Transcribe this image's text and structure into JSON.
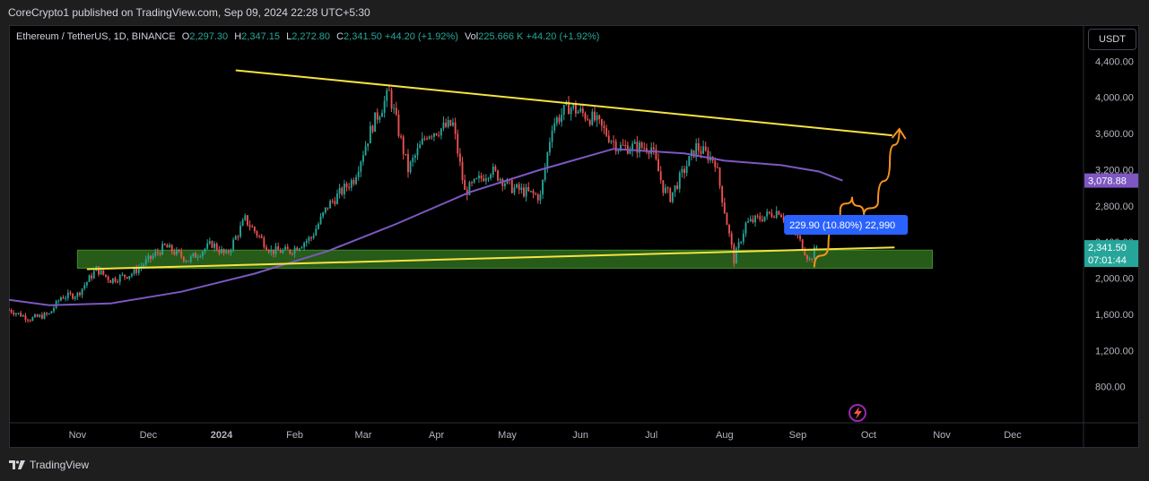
{
  "header": {
    "published_text": "CoreCrypto1 published on TradingView.com, Sep 09, 2024 22:28 UTC+5:30"
  },
  "legend": {
    "symbol": "Ethereum / TetherUS, 1D, BINANCE",
    "o_label": "O",
    "o_value": "2,297.30",
    "h_label": "H",
    "h_value": "2,347.15",
    "l_label": "L",
    "l_value": "2,272.80",
    "c_label": "C",
    "c_value": "2,341.50",
    "change": "+44.20 (+1.92%)",
    "vol_label": "Vol",
    "vol_value": "225.666 K",
    "vol_change": "+44.20 (+1.92%)"
  },
  "currency_button": "USDT",
  "footer": {
    "brand": "TradingView"
  },
  "colors": {
    "up": "#26a69a",
    "down": "#ef5350",
    "ma": "#7e57c2",
    "trendline": "#f6e33f",
    "support_zone": "#2e6b1f",
    "projection": "#f7931a",
    "measure": "#2962ff"
  },
  "icons": {
    "logo": "tradingview-logo-icon",
    "lightning": "lightning-icon"
  },
  "chart_data": {
    "type": "candlestick",
    "y_ticks": [
      "4,400.00",
      "4,000.00",
      "3,600.00",
      "3,200.00",
      "2,800.00",
      "2,400.00",
      "2,000.00",
      "1,600.00",
      "1,200.00",
      "800.00"
    ],
    "y_tick_values": [
      4400,
      4000,
      3600,
      3200,
      2800,
      2400,
      2000,
      1600,
      1200,
      800
    ],
    "ylim": [
      400,
      4800
    ],
    "x_ticks": [
      "Nov",
      "Dec",
      "2024",
      "Feb",
      "Mar",
      "Apr",
      "May",
      "Jun",
      "Jul",
      "Aug",
      "Sep",
      "Oct",
      "Nov",
      "Dec"
    ],
    "x_tick_dates": [
      "2023-11-01",
      "2023-12-01",
      "2024-01-01",
      "2024-02-01",
      "2024-03-01",
      "2024-04-01",
      "2024-05-01",
      "2024-06-01",
      "2024-07-01",
      "2024-08-01",
      "2024-09-01",
      "2024-10-01",
      "2024-11-01",
      "2024-12-01"
    ],
    "xlim": [
      "2023-10-03",
      "2024-12-31"
    ],
    "price_path": [
      [
        "2023-10-03",
        1650
      ],
      [
        "2023-10-12",
        1550
      ],
      [
        "2023-10-20",
        1600
      ],
      [
        "2023-10-25",
        1790
      ],
      [
        "2023-11-01",
        1820
      ],
      [
        "2023-11-09",
        2100
      ],
      [
        "2023-11-15",
        1980
      ],
      [
        "2023-11-24",
        2050
      ],
      [
        "2023-12-08",
        2350
      ],
      [
        "2023-12-18",
        2200
      ],
      [
        "2023-12-28",
        2380
      ],
      [
        "2024-01-03",
        2250
      ],
      [
        "2024-01-11",
        2650
      ],
      [
        "2024-01-22",
        2300
      ],
      [
        "2024-01-30",
        2300
      ],
      [
        "2024-02-08",
        2450
      ],
      [
        "2024-02-15",
        2800
      ],
      [
        "2024-02-26",
        3100
      ],
      [
        "2024-03-05",
        3700
      ],
      [
        "2024-03-12",
        4050
      ],
      [
        "2024-03-20",
        3200
      ],
      [
        "2024-03-28",
        3600
      ],
      [
        "2024-04-08",
        3700
      ],
      [
        "2024-04-13",
        2950
      ],
      [
        "2024-04-24",
        3200
      ],
      [
        "2024-05-03",
        3000
      ],
      [
        "2024-05-15",
        2900
      ],
      [
        "2024-05-20",
        3700
      ],
      [
        "2024-05-27",
        3900
      ],
      [
        "2024-06-07",
        3750
      ],
      [
        "2024-06-17",
        3450
      ],
      [
        "2024-07-01",
        3450
      ],
      [
        "2024-07-06",
        3000
      ],
      [
        "2024-07-09",
        2900
      ],
      [
        "2024-07-20",
        3450
      ],
      [
        "2024-07-28",
        3300
      ],
      [
        "2024-08-05",
        2200
      ],
      [
        "2024-08-10",
        2600
      ],
      [
        "2024-08-24",
        2750
      ],
      [
        "2024-09-01",
        2450
      ],
      [
        "2024-09-06",
        2200
      ],
      [
        "2024-09-09",
        2341.5
      ]
    ],
    "last_close": 2341.5,
    "moving_average": {
      "name": "",
      "current_value": "3,078.88",
      "points": [
        [
          "2023-10-03",
          1760
        ],
        [
          "2023-10-20",
          1700
        ],
        [
          "2023-11-15",
          1720
        ],
        [
          "2023-12-15",
          1850
        ],
        [
          "2024-01-15",
          2050
        ],
        [
          "2024-02-15",
          2300
        ],
        [
          "2024-03-15",
          2600
        ],
        [
          "2024-04-15",
          2950
        ],
        [
          "2024-05-15",
          3200
        ],
        [
          "2024-06-15",
          3430
        ],
        [
          "2024-07-15",
          3380
        ],
        [
          "2024-08-01",
          3300
        ],
        [
          "2024-08-25",
          3250
        ],
        [
          "2024-09-10",
          3180
        ],
        [
          "2024-09-20",
          3080
        ]
      ]
    },
    "price_labels": {
      "close_value": "2,341.50",
      "countdown": "07:01:44"
    },
    "annotations": {
      "descending_trendline": {
        "from": [
          "2024-01-07",
          4300
        ],
        "to": [
          "2024-10-11",
          3580
        ]
      },
      "ascending_trendline": {
        "from": [
          "2023-11-05",
          2100
        ],
        "to": [
          "2024-10-12",
          2340
        ]
      },
      "support_zone": {
        "from": "2023-11-01",
        "to": "2024-10-28",
        "low": 2110,
        "high": 2310
      },
      "projection_path": [
        [
          "2024-09-08",
          2120
        ],
        [
          "2024-09-14",
          2380
        ],
        [
          "2024-09-19",
          2750
        ],
        [
          "2024-09-24",
          2900
        ],
        [
          "2024-09-29",
          2700
        ],
        [
          "2024-10-05",
          2850
        ],
        [
          "2024-10-10",
          3300
        ],
        [
          "2024-10-14",
          3650
        ]
      ],
      "measure_label": "229.90 (10.80%) 22,990"
    }
  }
}
